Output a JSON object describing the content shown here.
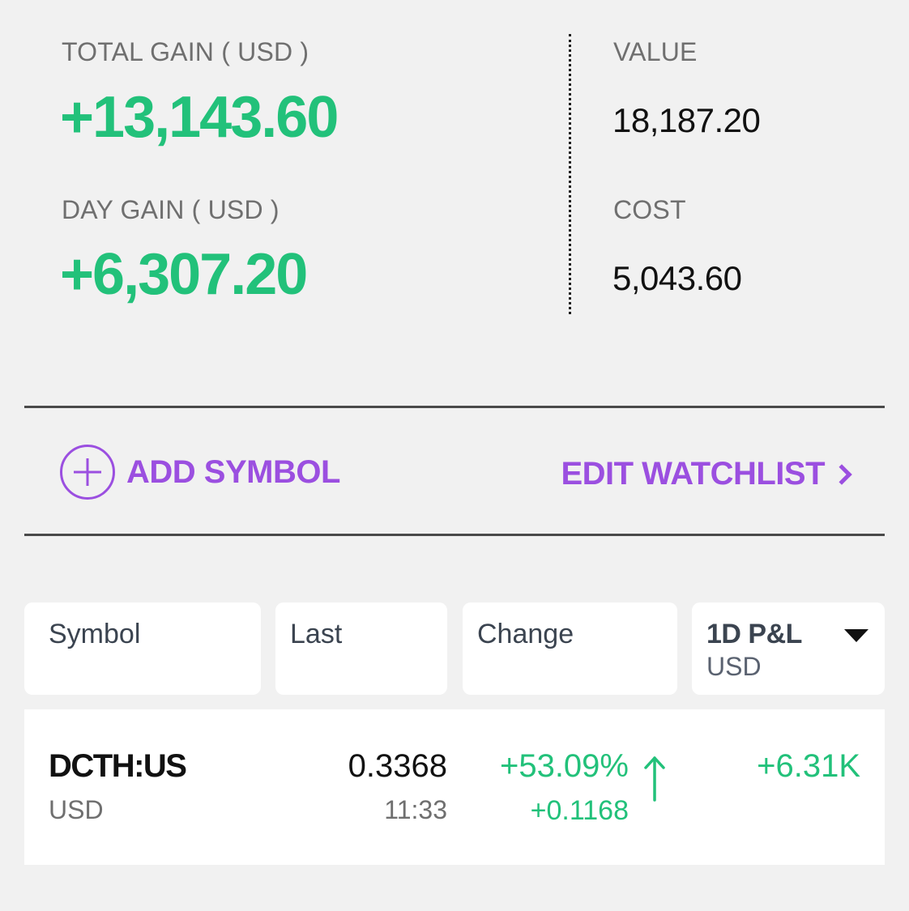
{
  "summary": {
    "total_gain_label": "TOTAL GAIN ( USD )",
    "total_gain_value": "+13,143.60",
    "day_gain_label": "DAY GAIN ( USD )",
    "day_gain_value": "+6,307.20",
    "value_label": "VALUE",
    "value_value": "18,187.20",
    "cost_label": "COST",
    "cost_value": "5,043.60"
  },
  "actions": {
    "add_symbol": "ADD SYMBOL",
    "edit_watchlist": "EDIT WATCHLIST"
  },
  "columns": {
    "symbol": "Symbol",
    "last": "Last",
    "change": "Change",
    "pnl_title": "1D P&L",
    "pnl_currency": "USD"
  },
  "rows": [
    {
      "symbol": "DCTH:US",
      "currency": "USD",
      "last": "0.3368",
      "time": "11:33",
      "change_pct": "+53.09%",
      "change_abs": "+0.1168",
      "direction": "up-arrow-icon",
      "pnl": "+6.31K"
    }
  ],
  "colors": {
    "gain": "#22c17a",
    "accent": "#9b4fe0",
    "background": "#f1f1f1"
  }
}
